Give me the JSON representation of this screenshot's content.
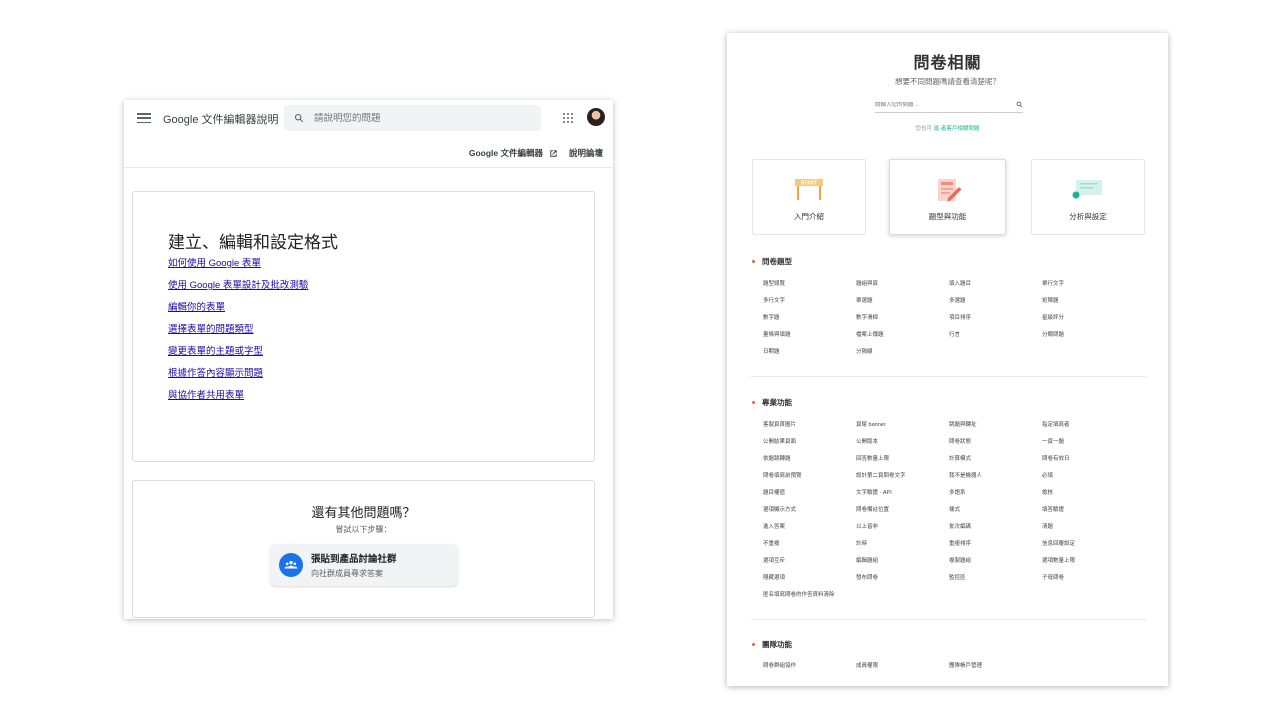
{
  "google_help": {
    "title": "Google 文件編輯器說明",
    "search_placeholder": "請說明您的問題",
    "subnav": {
      "editors_label": "Google 文件編輯器",
      "community_label": "說明論壇"
    },
    "topics": {
      "title": "建立、編輯和設定格式",
      "links": [
        "如何使用 Google 表單",
        "使用 Google 表單設計及批改測驗",
        "編輯你的表單",
        "選擇表單的問題類型",
        "變更表單的主題或字型",
        "根據作答內容顯示問題",
        "與協作者共用表單"
      ]
    },
    "more_help": {
      "title": "還有其他問題嗎？",
      "subtitle": "嘗試以下步驟：",
      "community_title": "張貼到產品討論社群",
      "community_subtitle": "向社群成員尋求答案"
    }
  },
  "survey_help": {
    "title": "問卷相關",
    "subtitle": "想要不同問題嗎請查看清楚呢？",
    "search_placeholder": "請輸入您的問題…",
    "contact_prefix": "您也可",
    "contact_link": "進·者客戶相關問題",
    "categories": [
      {
        "label": "入門介紹",
        "icon": "start-sign-icon"
      },
      {
        "label": "題型與功能",
        "icon": "form-pencil-icon"
      },
      {
        "label": "分析與設定",
        "icon": "chart-card-icon"
      }
    ],
    "sections": [
      {
        "title": "問卷題型",
        "items": [
          "題型總覽",
          "題組與頁",
          "填入題目",
          "單行文字",
          "多行文字",
          "單選題",
          "多選題",
          "矩陣題",
          "數字題",
          "數字滑桿",
          "項目排序",
          "星級評分",
          "量條與填題",
          "檔案上傳題",
          "行言",
          "分類問題",
          "日期題",
          "分隔線"
        ]
      },
      {
        "title": "專業功能",
        "items": [
          "客製頁首圖片",
          "頁尾 banner",
          "跳題與轉址",
          "指定填寫者",
          "公開結果頁面",
          "公開版本",
          "問卷狀態",
          "一頁一題",
          "依題跳轉題",
          "回答數量上限",
          "計算模式",
          "問卷有效日",
          "問卷填寫前預覽",
          "設計第二頁問卷文字",
          "我不是機器人",
          "必填",
          "題目權值",
          "文字驗證 · API",
          "多語系",
          "檢核",
          "選項顯示方式",
          "問卷備註位置",
          "樣式",
          "填答驗證",
          "進入答案",
          "以上皆非",
          "批次編碼",
          "清題",
          "不重複",
          "計時",
          "重複排序",
          "信息回覆設定",
          "選項互斥",
          "編輯題組",
          "複製題組",
          "選項數量上限",
          "隱藏選項",
          "發布問卷",
          "監控區",
          "子母問卷",
          "匿名填寫問卷的作答資料清除"
        ]
      },
      {
        "title": "團隊功能",
        "items": [
          "問卷群組協作",
          "成員權限",
          "團隊帳戶管理"
        ]
      }
    ]
  },
  "colors": {
    "google_link": "#1a0dab",
    "google_blue": "#1a73e8",
    "survey_accent": "#e8603c",
    "survey_green": "#19b394"
  }
}
